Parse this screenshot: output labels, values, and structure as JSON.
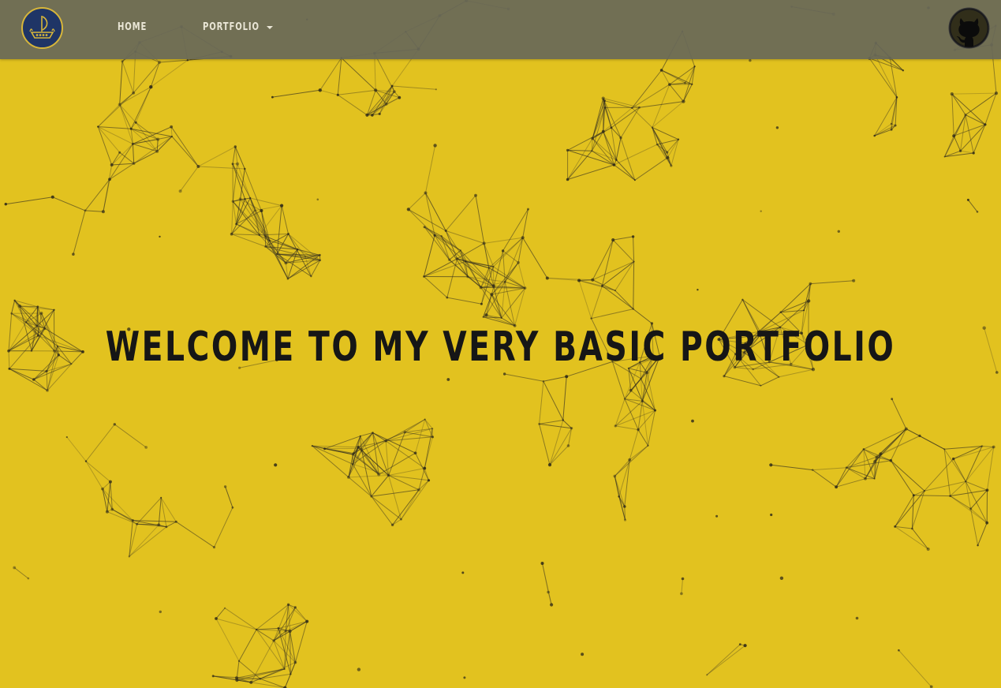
{
  "nav": {
    "home_label": "HOME",
    "portfolio_label": "PORTFOLIO",
    "logo_icon": "ship-logo-icon",
    "github_icon": "github-icon"
  },
  "hero": {
    "title": "WELCOME TO MY VERY BASIC PORTFOLIO"
  },
  "colors": {
    "background": "#e2c21f",
    "navbar": "#686858",
    "nav_text": "#eae6d6",
    "title_text": "#161616",
    "logo_navy": "#1f3566",
    "logo_gold": "#d7b63a"
  }
}
